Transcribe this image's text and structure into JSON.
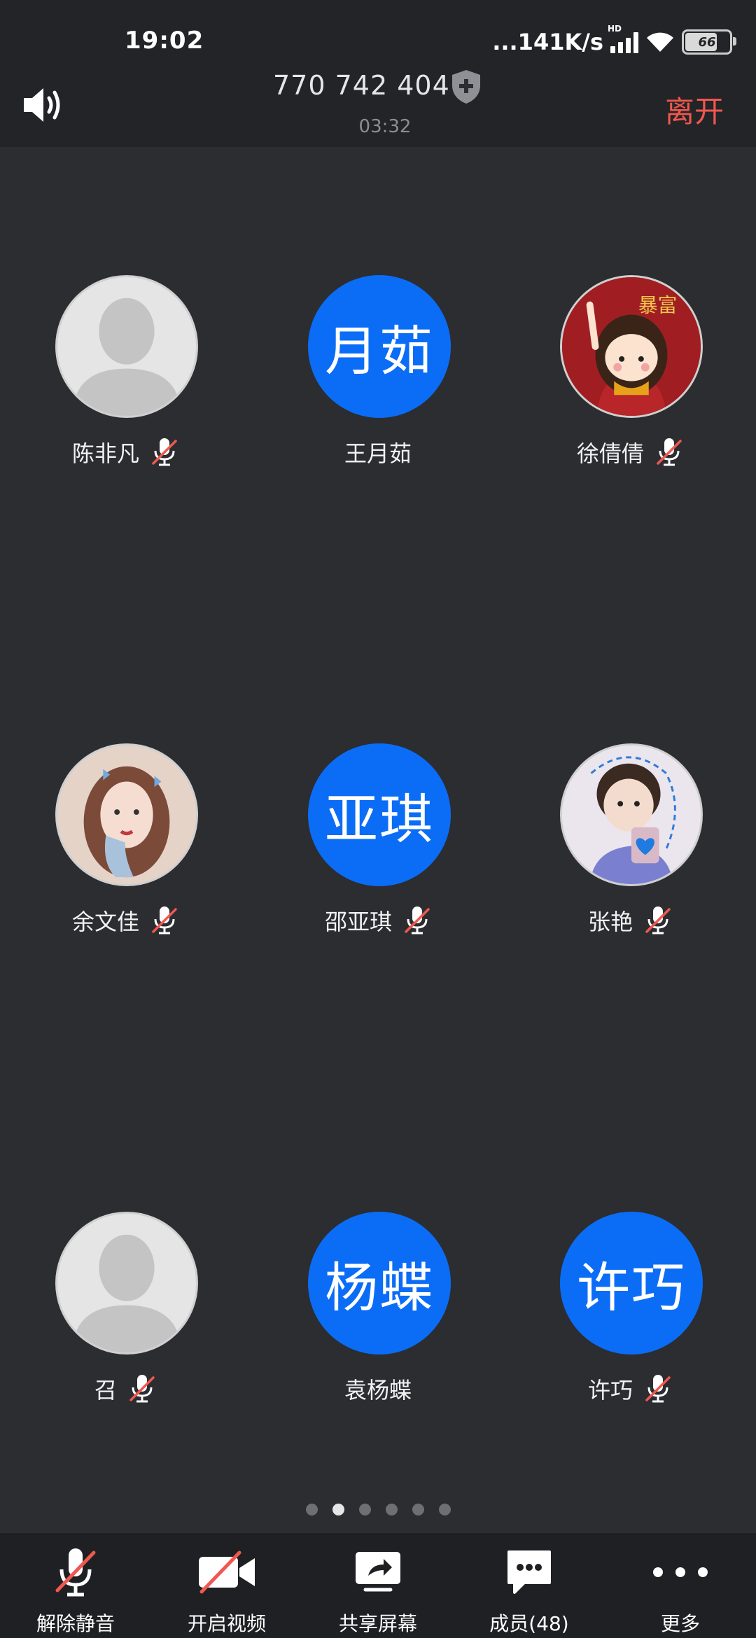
{
  "status_bar": {
    "time": "19:02",
    "net_speed": "...141K/s",
    "signal_tag": "HD",
    "battery": "66"
  },
  "header": {
    "meeting_id": "770 742 404",
    "duration": "03:32",
    "leave_label": "离开"
  },
  "participants": [
    {
      "name": "陈非凡",
      "avatar_type": "default",
      "avatar_text": "",
      "muted": true
    },
    {
      "name": "王月茹",
      "avatar_type": "initials",
      "avatar_text": "月茹",
      "muted": false
    },
    {
      "name": "徐倩倩",
      "avatar_type": "photo",
      "avatar_text": "暴富",
      "muted": true
    },
    {
      "name": "余文佳",
      "avatar_type": "photo",
      "avatar_text": "",
      "muted": true
    },
    {
      "name": "邵亚琪",
      "avatar_type": "initials",
      "avatar_text": "亚琪",
      "muted": true
    },
    {
      "name": "张艳",
      "avatar_type": "photo",
      "avatar_text": "",
      "muted": true
    },
    {
      "name": "召",
      "avatar_type": "default",
      "avatar_text": "",
      "muted": true
    },
    {
      "name": "袁杨蝶",
      "avatar_type": "initials",
      "avatar_text": "杨蝶",
      "muted": false
    },
    {
      "name": "许巧",
      "avatar_type": "initials",
      "avatar_text": "许巧",
      "muted": true
    }
  ],
  "pagination": {
    "total_pages": 6,
    "current_page": 2
  },
  "toolbar": {
    "unmute_label": "解除静音",
    "video_label": "开启视频",
    "share_label": "共享屏幕",
    "members_label": "成员(48)",
    "more_label": "更多"
  },
  "colors": {
    "accent": "#0b6df6",
    "danger": "#f0584f",
    "background": "#2b2d31"
  }
}
